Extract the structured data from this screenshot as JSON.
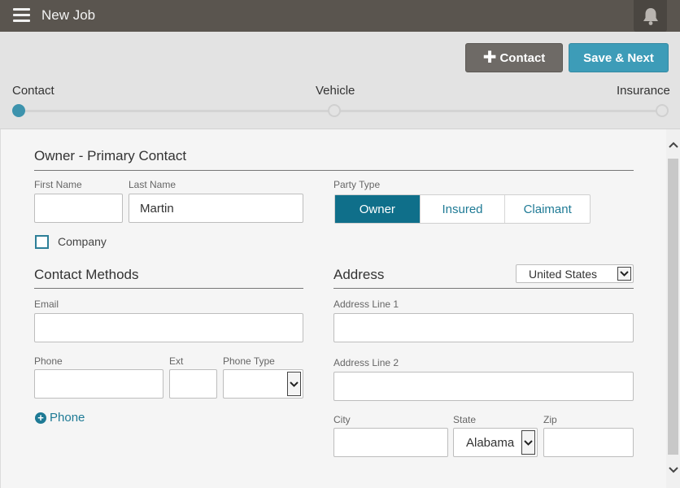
{
  "header": {
    "title": "New Job",
    "contact_button": "Contact",
    "save_next_button": "Save & Next"
  },
  "steps": [
    {
      "label": "Contact",
      "active": true
    },
    {
      "label": "Vehicle",
      "active": false
    },
    {
      "label": "Insurance",
      "active": false
    }
  ],
  "owner": {
    "section_title": "Owner - Primary Contact",
    "first_name_label": "First Name",
    "first_name_value": "",
    "last_name_label": "Last Name",
    "last_name_value": "Martin",
    "party_type_label": "Party Type",
    "party_types": [
      "Owner",
      "Insured",
      "Claimant"
    ],
    "party_type_selected": "Owner",
    "company_label": "Company",
    "company_checked": false
  },
  "contact_methods": {
    "section_title": "Contact Methods",
    "email_label": "Email",
    "email_value": "",
    "phone_label": "Phone",
    "phone_value": "",
    "ext_label": "Ext",
    "ext_value": "",
    "phone_type_label": "Phone Type",
    "phone_type_value": "",
    "add_phone_label": "Phone"
  },
  "address": {
    "section_title": "Address",
    "country_value": "United States",
    "line1_label": "Address Line 1",
    "line1_value": "",
    "line2_label": "Address Line 2",
    "line2_value": "",
    "city_label": "City",
    "city_value": "",
    "state_label": "State",
    "state_value": "Alabama",
    "zip_label": "Zip",
    "zip_value": ""
  },
  "colors": {
    "topbar": "#5a554f",
    "accent": "#3d9cb8",
    "active_segment": "#0f6f8a"
  },
  "icons": [
    "menu-icon",
    "bell-icon",
    "plus-icon",
    "chevron-down-icon",
    "plus-circle-icon",
    "scroll-up-icon",
    "scroll-down-icon"
  ]
}
